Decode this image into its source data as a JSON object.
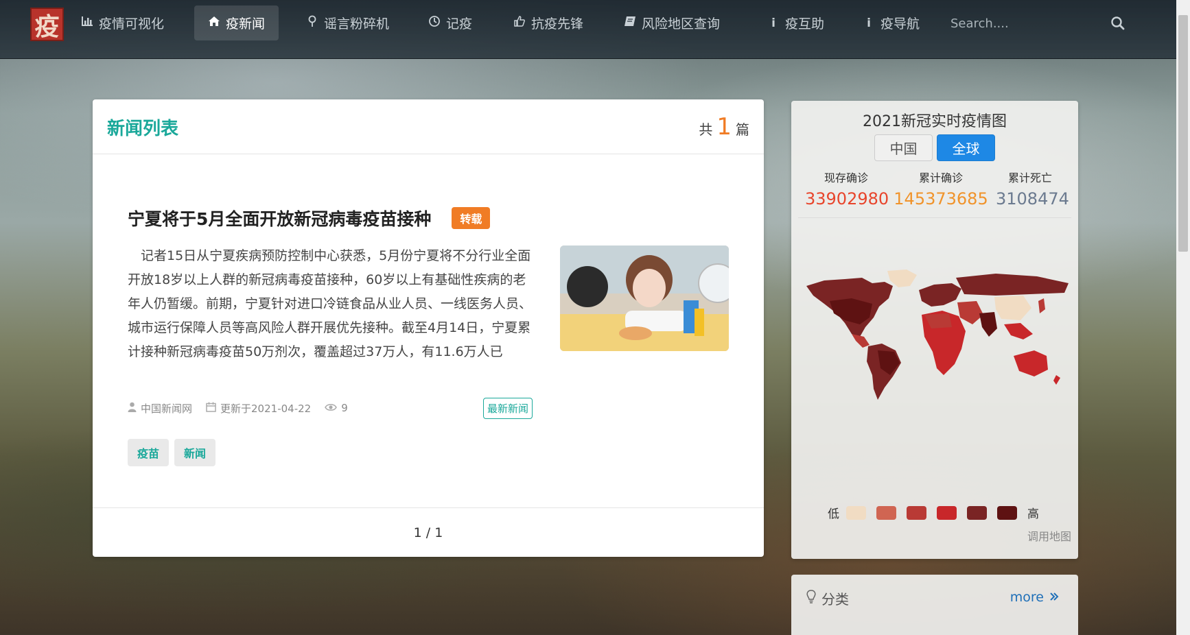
{
  "navbar": {
    "logo_char": "疫",
    "items": [
      {
        "label": "疫情可视化",
        "icon": "bar-chart-icon",
        "active": false
      },
      {
        "label": "疫新闻",
        "icon": "home-icon",
        "active": true
      },
      {
        "label": "谣言粉碎机",
        "icon": "map-pin-icon",
        "active": false
      },
      {
        "label": "记疫",
        "icon": "clock-icon",
        "active": false
      },
      {
        "label": "抗疫先锋",
        "icon": "thumbs-up-icon",
        "active": false
      },
      {
        "label": "风险地区查询",
        "icon": "book-icon",
        "active": false
      },
      {
        "label": "疫互助",
        "icon": "info-icon",
        "active": false
      },
      {
        "label": "疫导航",
        "icon": "info-icon",
        "active": false
      }
    ],
    "search_placeholder": "Search...."
  },
  "news": {
    "title": "新闻列表",
    "count_prefix": "共",
    "count": "1",
    "count_suffix": "篇",
    "article": {
      "title": "宁夏将于5月全面开放新冠病毒疫苗接种",
      "badge": "转载",
      "summary": "记者15日从宁夏疾病预防控制中心获悉，5月份宁夏将不分行业全面开放18岁以上人群的新冠病毒疫苗接种，60岁以上有基础性疾病的老年人仍暂缓。前期，宁夏针对进口冷链食品从业人员、一线医务人员、城市运行保障人员等高风险人群开展优先接种。截至4月14日，宁夏累计接种新冠病毒疫苗50万剂次，覆盖超过37万人，有11.6万人已",
      "source": "中国新闻网",
      "updated": "更新于2021-04-22",
      "views": "9",
      "latest_badge": "最新新闻",
      "tags": [
        "疫苗",
        "新闻"
      ]
    },
    "pager": "1 / 1"
  },
  "map": {
    "title": "2021新冠实时疫情图",
    "tab_china": "中国",
    "tab_global": "全球",
    "stats": [
      {
        "label": "现存确诊",
        "value": "33902980",
        "color": "#e8452c"
      },
      {
        "label": "累计确诊",
        "value": "145373685",
        "color": "#f0932b"
      },
      {
        "label": "累计死亡",
        "value": "3108474",
        "color": "#6b7a8f"
      }
    ],
    "legend_low": "低",
    "legend_high": "高",
    "legend_colors": [
      "#f1dcc3",
      "#d06552",
      "#b93a35",
      "#c8272a",
      "#7a2424",
      "#5e1212"
    ],
    "footnote": "调用地图"
  },
  "category": {
    "title": "分类",
    "more": "more"
  }
}
